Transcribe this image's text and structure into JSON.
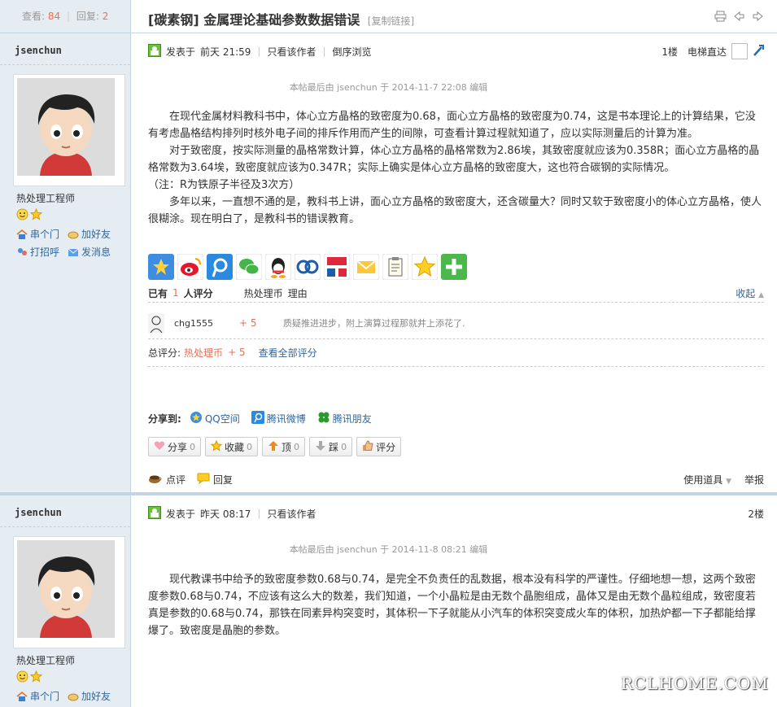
{
  "thread": {
    "views_label": "查看:",
    "views": "84",
    "sep": "|",
    "replies_label": "回复:",
    "replies": "2",
    "title": "[碳素钢] 金属理论基础参数数据错误",
    "copy_link": "[复制链接]"
  },
  "posts": [
    {
      "author": "jsenchun",
      "group": "热处理工程师",
      "links": [
        "串个门",
        "加好友",
        "打招呼",
        "发消息"
      ],
      "posted_label": "发表于",
      "posted_time": "前天 21:59",
      "only_author": "只看该作者",
      "reverse": "倒序浏览",
      "floor": "1楼",
      "elevator": "电梯直达",
      "last_edit": "本帖最后由 jsenchun 于 2014-11-7 22:08 编辑",
      "paragraphs": [
        "在现代金属材料教科书中，体心立方晶格的致密度为0.68，面心立方晶格的致密度为0.74，这是书本理论上的计算结果，它没有考虑晶格结构排列时核外电子间的排斥作用而产生的间隙，可查看计算过程就知道了，应以实际测量后的计算为准。",
        "对于致密度，按实际测量的晶格常数计算，体心立方晶格的晶格常数为2.86埃，其致密度就应该为0.358R；面心立方晶格的晶格常数为3.64埃，致密度就应该为0.347R；实际上确实是体心立方晶格的致密度大，这也符合碳钢的实际情况。",
        "（注：R为铁原子半径及3次方）",
        "多年以来，一直想不通的是，教科书上讲，面心立方晶格的致密度大，还含碳量大？同时又软于致密度小的体心立方晶格，使人很糊涂。现在明白了，是教科书的错误教育。"
      ],
      "rating": {
        "prefix": "已有",
        "count": "1",
        "suffix": "人评分",
        "col_coin": "热处理币",
        "col_reason": "理由",
        "collapse": "收起",
        "rows": [
          {
            "user": "chg1555",
            "score": "+ 5",
            "reason": "质疑推进进步，附上演算过程那就井上添花了."
          }
        ],
        "total_label": "总评分:",
        "total_coin": "热处理币",
        "total_score": "+ 5",
        "view_all": "查看全部评分"
      },
      "share_to": {
        "label": "分享到:",
        "items": [
          "QQ空间",
          "腾讯微博",
          "腾讯朋友"
        ]
      },
      "buttons": [
        {
          "label": "分享",
          "count": "0"
        },
        {
          "label": "收藏",
          "count": "0"
        },
        {
          "label": "顶",
          "count": "0"
        },
        {
          "label": "踩",
          "count": "0"
        },
        {
          "label": "评分",
          "count": ""
        }
      ],
      "footer": {
        "comment": "点评",
        "reply": "回复",
        "tools": "使用道具",
        "report": "举报"
      }
    },
    {
      "author": "jsenchun",
      "group": "热处理工程师",
      "links": [
        "串个门",
        "加好友"
      ],
      "posted_label": "发表于",
      "posted_time": "昨天 08:17",
      "only_author": "只看该作者",
      "floor": "2楼",
      "last_edit": "本帖最后由 jsenchun 于 2014-11-8 08:21 编辑",
      "paragraphs": [
        "现代教课书中给予的致密度参数0.68与0.74，是完全不负责任的乱数据，根本没有科学的严谨性。仔细地想一想，这两个致密度参数0.68与0.74，不应该有这么大的数差，我们知道，一个小晶粒是由无数个晶胞组成，晶体又是由无数个晶粒组成，致密度若真是参数的0.68与0.74，那铁在同素异构突变时，其体积一下子就能从小汽车的体积突变成火车的体积，加热炉都一下子都能给撑爆了。致密度是晶胞的参数。"
      ]
    }
  ],
  "watermark": "RCLHOME.COM"
}
